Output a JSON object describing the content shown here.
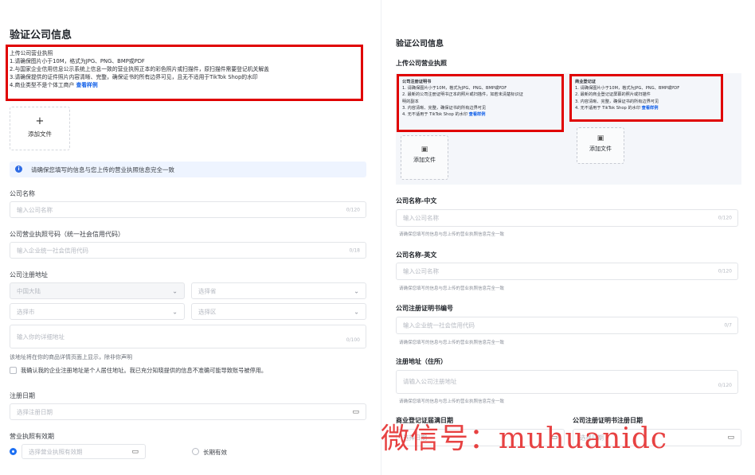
{
  "left": {
    "title": "验证公司信息",
    "upload_heading": "上传公司营业执照",
    "requirements": [
      "1.请确保图片小于10M，格式为JPG、PNG、BMP或PDF",
      "2.与国家企业信用信息公示系统上信息一致的营业执照正本的彩色照片或扫描件，原扫描件需要登记机关解盖",
      "3.请确保提供的证件照片内容清晰、完整，确保证书的所有边界可见，且无不适用于TikTok Shop的水印"
    ],
    "req_last": "4.商业类型不是个体工商户",
    "sample_link": "查看样例",
    "upload_plus": "+",
    "upload_label": "添加文件",
    "info_text": "请确保您填写的信息与您上传的营业执照信息完全一致",
    "company_name_label": "公司名称",
    "company_name_placeholder": "输入公司名称",
    "company_name_count": "0/120",
    "license_label": "公司营业执照号码（统一社会信用代码）",
    "license_placeholder": "输入企业统一社会信用代码",
    "license_count": "0/18",
    "address_label": "公司注册地址",
    "country_value": "中国大陆",
    "province_placeholder": "选择省",
    "city_placeholder": "选择市",
    "district_placeholder": "选择区",
    "address_placeholder": "输入你的详细地址",
    "address_count": "0/100",
    "address_note": "该地址将在你的商品详情页面上显示，除非你声明",
    "confirm_text": "我确认我的企业注册地址是个人居住地址。我已充分知晓提供的信息不准确可能导致账号被停用。",
    "reg_date_label": "注册日期",
    "reg_date_placeholder": "选择注册日期",
    "validity_label": "营业执照有效期",
    "validity_placeholder": "选择营业执照有效期",
    "long_term_label": "长期有效"
  },
  "right": {
    "title": "验证公司信息",
    "upload_heading": "上传公司营业执照",
    "cert_title": "公司注册证明书",
    "cert_lines": [
      "1. 请确保图片小于10M，格式为JPG、PNG、BMP或PDF",
      "2. 最新的公司注册证明书正本的照片或扫描件，如若未清楚标识证",
      "明的副本",
      "3. 内容清晰、完整，确保证书的所有边界可见"
    ],
    "cert_last": "4. 无不适用于 TikTok Shop 的水印",
    "br_title": "商业登记证",
    "br_lines": [
      "1. 请确保图片小于10M，格式为JPG、PNG、BMP或PDF",
      "2. 最新的商业登记证屏幕的照片或扫描件",
      "3. 内容清晰、完整，确保证书的所有边界可见"
    ],
    "br_last": "4. 无不适用于 TikTok Shop 的水印",
    "sample_link": "查看样例",
    "upload_label": "添加文件",
    "cn_name_label": "公司名称-中文",
    "cn_name_placeholder": "输入公司名称",
    "cn_name_count": "0/120",
    "hint": "请确保您填写的信息与您上传的营业执照信息完全一致",
    "en_name_label": "公司名称-英文",
    "en_name_placeholder": "输入公司名称",
    "en_name_count": "0/120",
    "cert_no_label": "公司注册证明书编号",
    "cert_no_placeholder": "输入企业统一社会信用代码",
    "cert_no_count": "0/7",
    "address_label": "注册地址（住所）",
    "address_placeholder": "请输入公司注册地址",
    "address_count": "0/120",
    "br_expiry_label": "商业登记证届满日期",
    "br_expiry_placeholder": "选择日期",
    "cert_reg_label": "公司注册证明书注册日期",
    "cert_reg_placeholder": "选择日期"
  },
  "watermark": "微信号：muhuanidc",
  "icons": {
    "info": "i",
    "chevron": "⌄",
    "calendar": "▭",
    "image": "▣"
  }
}
